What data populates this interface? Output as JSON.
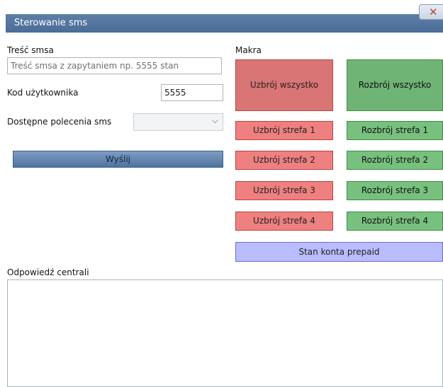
{
  "window": {
    "title": "Sterowanie sms",
    "close_glyph": "✕"
  },
  "sms": {
    "label": "Treść smsa",
    "placeholder": "Treść smsa z zapytaniem np. 5555 stan"
  },
  "user_code": {
    "label": "Kod użytkownika",
    "value": "5555"
  },
  "commands": {
    "label": "Dostępne polecenia sms",
    "selected": ""
  },
  "send_label": "Wyślij",
  "macros": {
    "label": "Makra",
    "arm_all": "Uzbrój wszystko",
    "disarm_all": "Rozbrój wszystko",
    "arm_zones": [
      "Uzbrój strefa 1",
      "Uzbrój strefa 2",
      "Uzbrój strefa 3",
      "Uzbrój strefa 4"
    ],
    "disarm_zones": [
      "Rozbrój strefa 1",
      "Rozbrój strefa 2",
      "Rozbrój strefa 3",
      "Rozbrój strefa 4"
    ],
    "prepaid": "Stan konta prepaid"
  },
  "response": {
    "label": "Odpowiedź centrali",
    "text": ""
  },
  "colors": {
    "title_bar": "#4f729e",
    "arm": "#ef8080",
    "disarm": "#78c07e",
    "prepaid": "#b9bcff"
  },
  "icons": {
    "close": "close-icon",
    "dropdown": "chevron-down-icon"
  }
}
